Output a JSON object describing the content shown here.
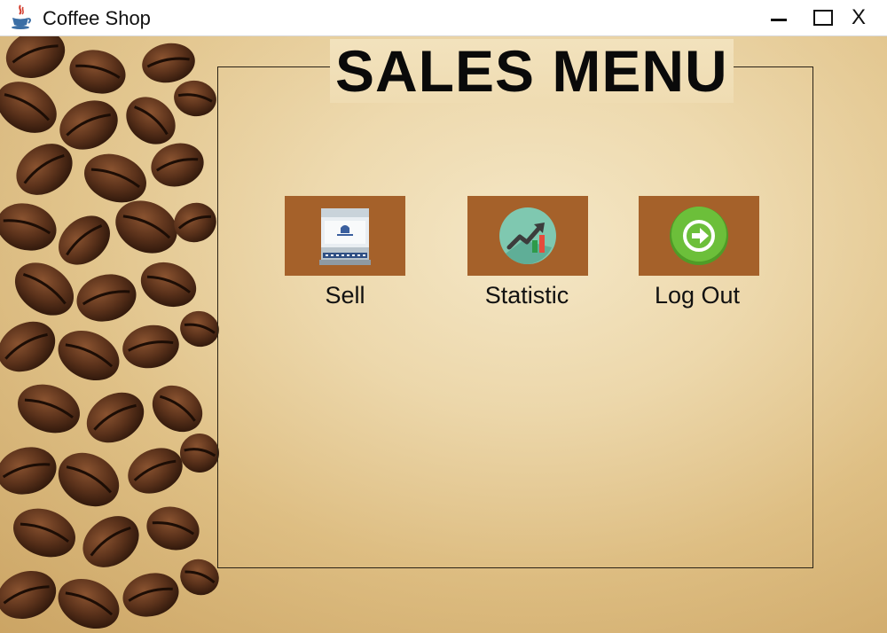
{
  "window": {
    "title": "Coffee Shop",
    "icons": {
      "app": "java-cup-icon",
      "minimize": "minimize-icon",
      "maximize": "maximize-icon",
      "close_label": "X"
    }
  },
  "panel": {
    "title": "SALES MENU"
  },
  "menu": {
    "items": [
      {
        "label": "Sell",
        "icon": "cash-register-icon"
      },
      {
        "label": "Statistic",
        "icon": "chart-trend-icon"
      },
      {
        "label": "Log Out",
        "icon": "logout-arrow-icon"
      }
    ]
  },
  "colors": {
    "button_bg": "#a5612a",
    "title_text": "#0a0a0a",
    "logout_green": "#6cbf3a"
  }
}
